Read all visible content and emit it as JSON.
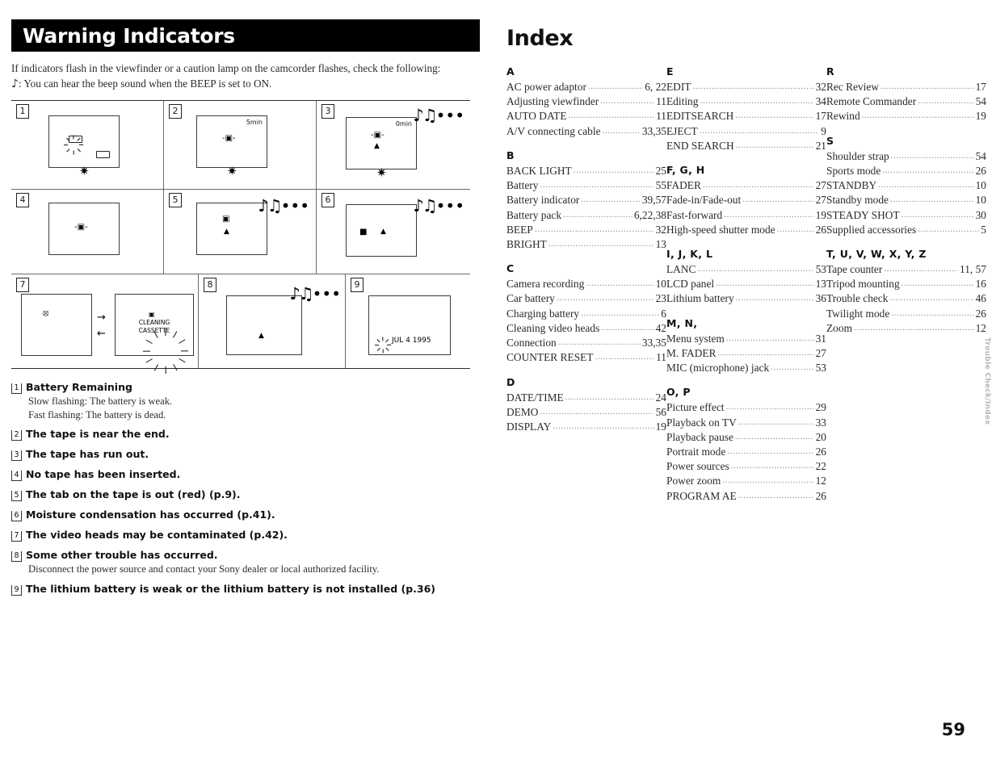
{
  "page": {
    "number": "59",
    "running_head": "Trouble Check/Index"
  },
  "warning": {
    "heading": "Warning Indicators",
    "intro_line1": "If indicators flash in the viewfinder or a caution lamp on the camcorder flashes, check the following:",
    "note_glyph": "♪",
    "intro_line2": ": You can hear the beep sound when the BEEP is set to ON.",
    "cells": [
      {
        "num": "1",
        "screen_label": "",
        "date": "",
        "has_music": false,
        "has_lamp": true
      },
      {
        "num": "2",
        "screen_label": "5min",
        "date": "",
        "has_music": false,
        "has_lamp": true
      },
      {
        "num": "3",
        "screen_label": "0min",
        "date": "",
        "has_music": true,
        "has_lamp": true
      },
      {
        "num": "4",
        "screen_label": "",
        "date": "",
        "has_music": false,
        "has_lamp": false
      },
      {
        "num": "5",
        "screen_label": "",
        "date": "",
        "has_music": true,
        "has_lamp": false
      },
      {
        "num": "6",
        "screen_label": "",
        "date": "",
        "has_music": true,
        "has_lamp": false
      },
      {
        "num": "7",
        "screen_label": "",
        "cleaning_line1": "CLEANING",
        "cleaning_line2": "CASSETTE",
        "has_music": false,
        "has_lamp": false
      },
      {
        "num": "8",
        "screen_label": "",
        "date": "",
        "has_music": true,
        "has_lamp": false
      },
      {
        "num": "9",
        "screen_label": "",
        "date": "JUL 4 1995",
        "has_music": false,
        "has_lamp": false
      }
    ],
    "music_notes": "♪♫",
    "music_dots": "•••",
    "legend": [
      {
        "num": "1",
        "title": "Battery Remaining",
        "sub1": "Slow flashing: The battery is weak.",
        "sub2": "Fast flashing: The battery is dead."
      },
      {
        "num": "2",
        "title": "The tape is near the end."
      },
      {
        "num": "3",
        "title": "The tape has run out."
      },
      {
        "num": "4",
        "title": "No tape has been inserted."
      },
      {
        "num": "5",
        "title": "The tab on the tape is out (red) (p.9)."
      },
      {
        "num": "6",
        "title": "Moisture condensation has occurred (p.41)."
      },
      {
        "num": "7",
        "title": "The video heads may be contaminated (p.42)."
      },
      {
        "num": "8",
        "title": "Some other trouble has occurred.",
        "sub1": "Disconnect the power source and contact your Sony dealer or local authorized facility."
      },
      {
        "num": "9",
        "title": "The lithium battery is weak or the lithium battery is not installed (p.36)"
      }
    ]
  },
  "index": {
    "title": "Index",
    "leader": "..................................................",
    "columns": [
      {
        "groups": [
          {
            "letter": "A",
            "entries": [
              {
                "term": "AC power adaptor",
                "page": "6, 22"
              },
              {
                "term": "Adjusting viewfinder",
                "page": "11"
              },
              {
                "term": "AUTO DATE",
                "page": "11"
              },
              {
                "term": "A/V connecting cable",
                "page": "33,35"
              }
            ]
          },
          {
            "letter": "B",
            "entries": [
              {
                "term": "BACK LIGHT",
                "page": "25"
              },
              {
                "term": "Battery",
                "page": "55"
              },
              {
                "term": "Battery indicator",
                "page": "39,57"
              },
              {
                "term": "Battery pack",
                "page": "6,22,38"
              },
              {
                "term": "BEEP",
                "page": "32"
              },
              {
                "term": "BRIGHT",
                "page": "13"
              }
            ]
          },
          {
            "letter": "C",
            "entries": [
              {
                "term": "Camera recording",
                "page": "10"
              },
              {
                "term": "Car battery",
                "page": "23"
              },
              {
                "term": "Charging battery",
                "page": "6"
              },
              {
                "term": "Cleaning video heads",
                "page": "42"
              },
              {
                "term": "Connection",
                "page": "33,35"
              },
              {
                "term": "COUNTER RESET",
                "page": "11"
              }
            ]
          },
          {
            "letter": "D",
            "entries": [
              {
                "term": "DATE/TIME",
                "page": "24"
              },
              {
                "term": "DEMO",
                "page": "56"
              },
              {
                "term": "DISPLAY",
                "page": "19"
              }
            ]
          }
        ]
      },
      {
        "groups": [
          {
            "letter": "E",
            "entries": [
              {
                "term": "EDIT",
                "page": "32"
              },
              {
                "term": "Editing",
                "page": "34"
              },
              {
                "term": "EDITSEARCH",
                "page": "17"
              },
              {
                "term": "EJECT",
                "page": "9"
              },
              {
                "term": "END SEARCH",
                "page": "21"
              }
            ]
          },
          {
            "letter": "F, G, H",
            "entries": [
              {
                "term": "FADER",
                "page": "27"
              },
              {
                "term": "Fade-in/Fade-out",
                "page": "27"
              },
              {
                "term": "Fast-forward",
                "page": "19"
              },
              {
                "term": "High-speed shutter mode",
                "page": "26"
              }
            ]
          },
          {
            "letter": "I, J, K, L",
            "entries": [
              {
                "term": "LANC",
                "page": "53"
              },
              {
                "term": "LCD panel",
                "page": "13"
              },
              {
                "term": "Lithium battery",
                "page": "36"
              }
            ]
          },
          {
            "letter": "M, N,",
            "entries": [
              {
                "term": "Menu system",
                "page": "31"
              },
              {
                "term": "M. FADER",
                "page": "27"
              },
              {
                "term": "MIC (microphone) jack",
                "page": "53"
              }
            ]
          },
          {
            "letter": "O, P",
            "entries": [
              {
                "term": "Picture effect",
                "page": "29"
              },
              {
                "term": "Playback on TV",
                "page": "33"
              },
              {
                "term": "Playback pause",
                "page": "20"
              },
              {
                "term": "Portrait mode",
                "page": "26"
              },
              {
                "term": "Power sources",
                "page": "22"
              },
              {
                "term": "Power zoom",
                "page": "12"
              },
              {
                "term": "PROGRAM AE",
                "page": "26"
              }
            ]
          }
        ]
      },
      {
        "groups": [
          {
            "letter": "R",
            "entries": [
              {
                "term": "Rec Review",
                "page": "17"
              },
              {
                "term": "Remote Commander",
                "page": "54"
              },
              {
                "term": "Rewind",
                "page": "19"
              }
            ]
          },
          {
            "letter": "S",
            "entries": [
              {
                "term": "Shoulder strap",
                "page": "54"
              },
              {
                "term": "Sports mode",
                "page": "26"
              },
              {
                "term": "STANDBY",
                "page": "10"
              },
              {
                "term": "Standby mode",
                "page": "10"
              },
              {
                "term": "STEADY SHOT",
                "page": "30"
              },
              {
                "term": "Supplied accessories",
                "page": "5"
              }
            ]
          },
          {
            "letter": "T, U, V, W, X, Y, Z",
            "entries": [
              {
                "term": "Tape counter",
                "page": "11, 57"
              },
              {
                "term": "Tripod mounting",
                "page": "16"
              },
              {
                "term": "Trouble check",
                "page": "46"
              },
              {
                "term": "Twilight mode",
                "page": "26"
              },
              {
                "term": "Zoom",
                "page": "12"
              }
            ]
          }
        ]
      }
    ]
  }
}
